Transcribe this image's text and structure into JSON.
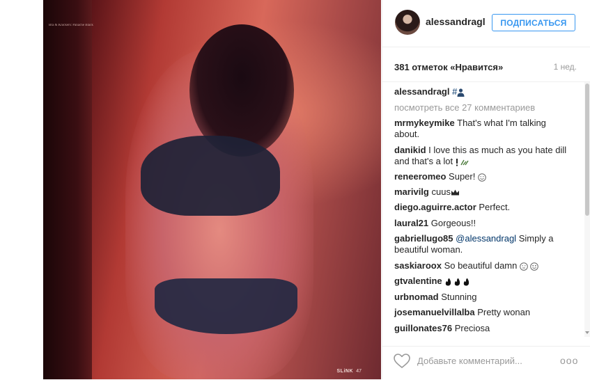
{
  "photo": {
    "credit": "Bra & Knickers: Panache Black",
    "magazine_logo": "SLiNK",
    "page_number": "47"
  },
  "header": {
    "username": "alessandragl",
    "follow_label": "ПОДПИСАТЬСЯ"
  },
  "stats": {
    "likes": "381 отметок «Нравится»",
    "time": "1 нед."
  },
  "caption": {
    "username": "alessandragl",
    "text": "#"
  },
  "view_all": "посмотреть все 27 комментариев",
  "comments": [
    {
      "user": "mrmykeymike",
      "text": "That's what I'm talking about."
    },
    {
      "user": "danikid",
      "text": "I love this as much as you hate dill and that's a lot "
    },
    {
      "user": "reneeromeo",
      "text": "Super! "
    },
    {
      "user": "marivilg",
      "text": "cuus"
    },
    {
      "user": "diego.aguirre.actor",
      "text": "Perfect."
    },
    {
      "user": "laural21",
      "text": "Gorgeous!!"
    },
    {
      "user": "gabriellugo85",
      "mention": "@alessandragl",
      "text": " Simply a beautiful woman."
    },
    {
      "user": "saskiaroox",
      "text": "So beautiful damn "
    },
    {
      "user": "gtvalentine",
      "text": ""
    },
    {
      "user": "urbnomad",
      "text": "Stunning"
    },
    {
      "user": "josemanuelvillalba",
      "text": "Pretty wonan"
    },
    {
      "user": "guillonates76",
      "text": "Preciosa"
    }
  ],
  "footer": {
    "comment_placeholder": "Добавьте комментарий...",
    "more_label": "ooo"
  },
  "colors": {
    "accent": "#3897f0",
    "text": "#262626",
    "muted": "#999999",
    "border": "#efefef"
  }
}
